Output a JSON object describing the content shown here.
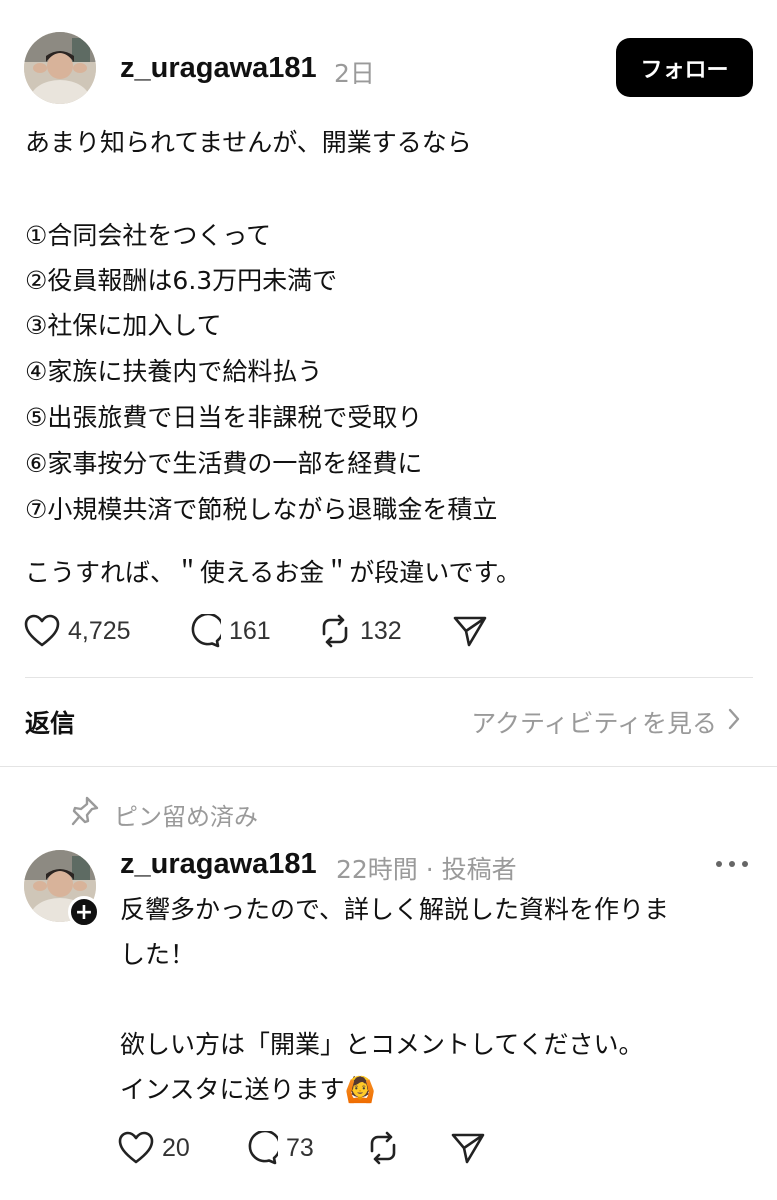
{
  "post": {
    "username": "z_uragawa181",
    "time": "2日",
    "follow_label": "フォロー",
    "lines": [
      "あまり知られてませんが、開業するなら",
      "①合同会社をつくって",
      "②役員報酬は6.3万円未満で",
      "③社保に加入して",
      "④家族に扶養内で給料払う",
      "⑤出張旅費で日当を非課税で受取り",
      "⑥家事按分で生活費の一部を経費に",
      "⑦小規模共済で節税しながら退職金を積立",
      "こうすれば、＂使えるお金＂が段違いです。"
    ],
    "likes": "4,725",
    "comments": "161",
    "reposts": "132"
  },
  "replies_section": {
    "label": "返信",
    "activity_link": "アクティビティを見る"
  },
  "pinned_reply": {
    "pinned_label": "ピン留め済み",
    "username": "z_uragawa181",
    "meta": "22時間 · 投稿者",
    "lines": [
      "反響多かったので、詳しく解説した資料を作りま",
      "した！",
      "欲しい方は「開業」とコメントしてください。",
      "インスタに送ります🙆"
    ],
    "likes": "20",
    "comments": "73"
  },
  "icons": {
    "like": "heart-icon",
    "comment": "comment-bubble-icon",
    "repost": "repost-icon",
    "share": "send-icon",
    "pin": "pin-icon",
    "more": "more-icon",
    "chevron": "chevron-right-icon",
    "plus": "plus-icon"
  }
}
